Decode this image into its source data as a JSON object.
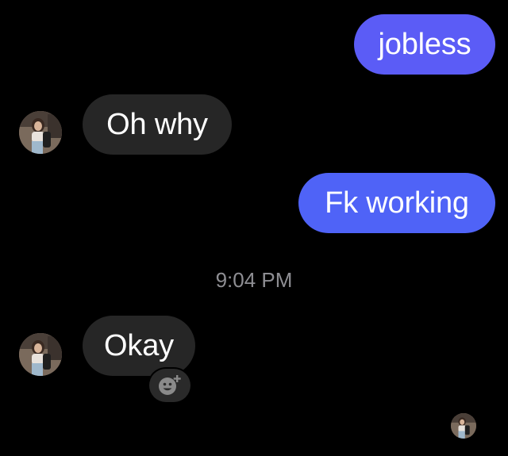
{
  "messages": [
    {
      "side": "sent",
      "text": "jobless"
    },
    {
      "side": "received",
      "text": "Oh why"
    },
    {
      "side": "sent",
      "text": "Fk working"
    },
    {
      "side": "received",
      "text": "Okay"
    }
  ],
  "timestamp": "9:04 PM",
  "icons": {
    "avatar": "contact-avatar-photo",
    "reaction": "add-reaction-icon",
    "seen": "seen-avatar"
  },
  "colors": {
    "background": "#000000",
    "sent_bubble": "#5b5cf6",
    "received_bubble": "#262626",
    "timestamp": "#8e8e93"
  }
}
